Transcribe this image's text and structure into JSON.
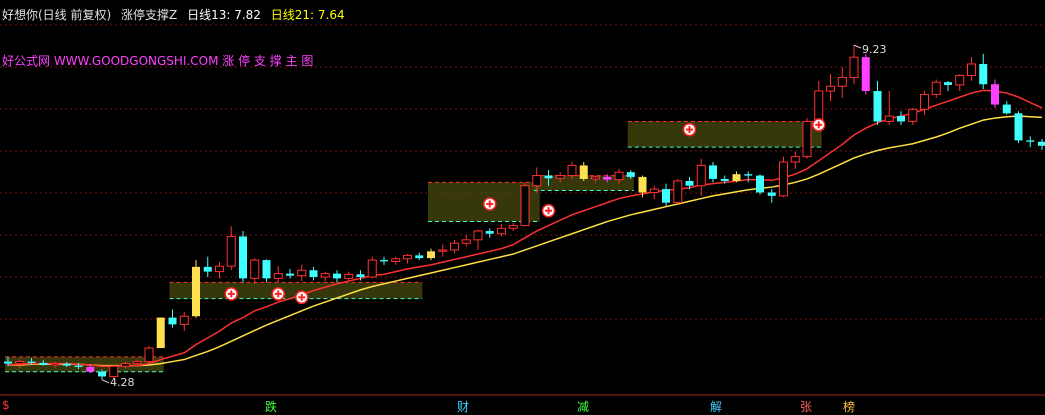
{
  "header": {
    "stock_name": "好想你(日线 前复权)",
    "indicator_name": "涨停支撑Z",
    "ma13_label": "日线13: 7.82",
    "ma21_label": "日线21: 7.64",
    "colors": {
      "name": "#e0e0e0",
      "ma13": "#ffffff",
      "ma21": "#ffff00"
    }
  },
  "watermark": "好公式网 WWW.GOODGONGSHI.COM 涨 停 支 撑 主 图",
  "annotations": {
    "high_label": "9.23",
    "low_label": "4.28"
  },
  "bottom_marks": [
    {
      "text": "$",
      "color": "#ff3030"
    },
    {
      "text": "跌",
      "color": "#40ff40"
    },
    {
      "text": "财",
      "color": "#40d0ff"
    },
    {
      "text": "减",
      "color": "#40ff40"
    },
    {
      "text": "解",
      "color": "#40d0ff"
    },
    {
      "text": "张",
      "color": "#ff6060"
    },
    {
      "text": "榜",
      "color": "#ffc040"
    }
  ],
  "chart_data": {
    "type": "candlestick",
    "ylim": [
      4.1,
      9.6
    ],
    "grid": true,
    "candles": [
      [
        4.55,
        4.62,
        4.48,
        4.52
      ],
      [
        4.52,
        4.58,
        4.45,
        4.55
      ],
      [
        4.55,
        4.6,
        4.5,
        4.53
      ],
      [
        4.53,
        4.57,
        4.49,
        4.5
      ],
      [
        4.5,
        4.55,
        4.46,
        4.52
      ],
      [
        4.52,
        4.54,
        4.47,
        4.49
      ],
      [
        4.49,
        4.53,
        4.44,
        4.47
      ],
      [
        4.47,
        4.5,
        4.38,
        4.4
      ],
      [
        4.4,
        4.43,
        4.28,
        4.33
      ],
      [
        4.33,
        4.5,
        4.3,
        4.48
      ],
      [
        4.48,
        4.55,
        4.45,
        4.52
      ],
      [
        4.52,
        4.58,
        4.49,
        4.55
      ],
      [
        4.55,
        4.78,
        4.53,
        4.75
      ],
      [
        4.75,
        5.2,
        4.75,
        5.2
      ],
      [
        5.2,
        5.32,
        5.05,
        5.1
      ],
      [
        5.1,
        5.28,
        5.0,
        5.22
      ],
      [
        5.22,
        6.05,
        5.2,
        5.95
      ],
      [
        5.95,
        6.1,
        5.8,
        5.88
      ],
      [
        5.88,
        6.02,
        5.78,
        5.96
      ],
      [
        5.96,
        6.55,
        5.9,
        6.4
      ],
      [
        6.4,
        6.48,
        5.72,
        5.78
      ],
      [
        5.78,
        6.08,
        5.7,
        6.05
      ],
      [
        6.05,
        6.06,
        5.72,
        5.78
      ],
      [
        5.78,
        5.96,
        5.72,
        5.85
      ],
      [
        5.85,
        5.92,
        5.78,
        5.82
      ],
      [
        5.82,
        5.98,
        5.74,
        5.9
      ],
      [
        5.9,
        5.95,
        5.75,
        5.8
      ],
      [
        5.8,
        5.88,
        5.74,
        5.85
      ],
      [
        5.85,
        5.9,
        5.72,
        5.78
      ],
      [
        5.78,
        5.88,
        5.74,
        5.84
      ],
      [
        5.84,
        5.9,
        5.75,
        5.8
      ],
      [
        5.8,
        6.1,
        5.78,
        6.05
      ],
      [
        6.05,
        6.1,
        5.98,
        6.03
      ],
      [
        6.03,
        6.1,
        5.98,
        6.07
      ],
      [
        6.07,
        6.14,
        6.0,
        6.12
      ],
      [
        6.12,
        6.16,
        6.05,
        6.08
      ],
      [
        6.08,
        6.22,
        6.05,
        6.18
      ],
      [
        6.18,
        6.28,
        6.1,
        6.2
      ],
      [
        6.2,
        6.35,
        6.15,
        6.3
      ],
      [
        6.3,
        6.42,
        6.25,
        6.35
      ],
      [
        6.35,
        6.5,
        6.2,
        6.48
      ],
      [
        6.48,
        6.52,
        6.38,
        6.44
      ],
      [
        6.44,
        6.58,
        6.4,
        6.52
      ],
      [
        6.52,
        6.6,
        6.48,
        6.56
      ],
      [
        6.56,
        7.2,
        6.55,
        7.15
      ],
      [
        7.15,
        7.42,
        7.05,
        7.3
      ],
      [
        7.3,
        7.38,
        7.15,
        7.26
      ],
      [
        7.26,
        7.35,
        7.2,
        7.3
      ],
      [
        7.3,
        7.5,
        7.25,
        7.45
      ],
      [
        7.45,
        7.5,
        7.22,
        7.25
      ],
      [
        7.25,
        7.3,
        7.2,
        7.28
      ],
      [
        7.28,
        7.32,
        7.2,
        7.24
      ],
      [
        7.24,
        7.4,
        7.18,
        7.35
      ],
      [
        7.35,
        7.38,
        7.25,
        7.28
      ],
      [
        7.28,
        7.3,
        6.98,
        7.05
      ],
      [
        7.05,
        7.15,
        6.95,
        7.1
      ],
      [
        7.1,
        7.18,
        6.85,
        6.9
      ],
      [
        6.9,
        7.25,
        6.88,
        7.22
      ],
      [
        7.22,
        7.28,
        7.1,
        7.15
      ],
      [
        7.15,
        7.55,
        7.0,
        7.45
      ],
      [
        7.45,
        7.5,
        7.2,
        7.25
      ],
      [
        7.25,
        7.3,
        7.18,
        7.22
      ],
      [
        7.22,
        7.36,
        7.2,
        7.32
      ],
      [
        7.32,
        7.36,
        7.2,
        7.3
      ],
      [
        7.3,
        7.32,
        7.02,
        7.05
      ],
      [
        7.05,
        7.1,
        6.9,
        7.0
      ],
      [
        7.0,
        7.58,
        6.98,
        7.5
      ],
      [
        7.5,
        7.65,
        7.4,
        7.58
      ],
      [
        7.58,
        8.15,
        7.55,
        8.1
      ],
      [
        8.1,
        8.7,
        8.05,
        8.55
      ],
      [
        8.55,
        8.8,
        8.4,
        8.62
      ],
      [
        8.62,
        8.9,
        8.45,
        8.75
      ],
      [
        8.75,
        9.23,
        8.65,
        9.05
      ],
      [
        9.05,
        9.1,
        8.5,
        8.55
      ],
      [
        8.55,
        8.7,
        8.05,
        8.1
      ],
      [
        8.1,
        8.55,
        8.05,
        8.18
      ],
      [
        8.18,
        8.25,
        8.05,
        8.1
      ],
      [
        8.1,
        8.3,
        8.05,
        8.28
      ],
      [
        8.28,
        8.55,
        8.2,
        8.5
      ],
      [
        8.5,
        8.72,
        8.45,
        8.68
      ],
      [
        8.68,
        8.7,
        8.55,
        8.64
      ],
      [
        8.64,
        8.8,
        8.55,
        8.78
      ],
      [
        8.78,
        9.05,
        8.7,
        8.95
      ],
      [
        8.95,
        9.1,
        8.58,
        8.65
      ],
      [
        8.65,
        8.72,
        8.3,
        8.35
      ],
      [
        8.35,
        8.4,
        8.2,
        8.22
      ],
      [
        8.22,
        8.25,
        7.78,
        7.82
      ],
      [
        7.82,
        7.88,
        7.72,
        7.8
      ],
      [
        7.8,
        7.84,
        7.68,
        7.74
      ]
    ],
    "ma13": [
      4.5,
      4.51,
      4.52,
      4.52,
      4.52,
      4.52,
      4.51,
      4.5,
      4.48,
      4.48,
      4.49,
      4.49,
      4.52,
      4.58,
      4.63,
      4.68,
      4.8,
      4.9,
      5.0,
      5.12,
      5.2,
      5.3,
      5.36,
      5.43,
      5.48,
      5.54,
      5.6,
      5.65,
      5.7,
      5.74,
      5.78,
      5.82,
      5.84,
      5.88,
      5.92,
      5.95,
      5.98,
      6.02,
      6.06,
      6.1,
      6.14,
      6.18,
      6.22,
      6.28,
      6.38,
      6.48,
      6.56,
      6.64,
      6.72,
      6.78,
      6.84,
      6.9,
      6.96,
      7.0,
      7.03,
      7.06,
      7.08,
      7.1,
      7.12,
      7.16,
      7.18,
      7.2,
      7.22,
      7.24,
      7.24,
      7.23,
      7.27,
      7.32,
      7.4,
      7.52,
      7.64,
      7.76,
      7.9,
      8.0,
      8.08,
      8.14,
      8.18,
      8.22,
      8.28,
      8.34,
      8.4,
      8.46,
      8.52,
      8.56,
      8.55,
      8.52,
      8.46,
      8.38,
      8.3
    ],
    "ma21": [
      4.5,
      4.5,
      4.51,
      4.51,
      4.51,
      4.51,
      4.51,
      4.5,
      4.49,
      4.49,
      4.49,
      4.49,
      4.5,
      4.52,
      4.55,
      4.58,
      4.64,
      4.7,
      4.77,
      4.85,
      4.93,
      5.01,
      5.09,
      5.16,
      5.23,
      5.3,
      5.37,
      5.43,
      5.49,
      5.55,
      5.61,
      5.66,
      5.7,
      5.74,
      5.78,
      5.82,
      5.86,
      5.9,
      5.94,
      5.98,
      6.02,
      6.06,
      6.1,
      6.14,
      6.2,
      6.26,
      6.32,
      6.38,
      6.44,
      6.5,
      6.56,
      6.62,
      6.67,
      6.72,
      6.76,
      6.8,
      6.84,
      6.88,
      6.92,
      6.96,
      7.0,
      7.03,
      7.06,
      7.09,
      7.11,
      7.13,
      7.16,
      7.2,
      7.25,
      7.32,
      7.4,
      7.48,
      7.56,
      7.62,
      7.67,
      7.71,
      7.74,
      7.77,
      7.82,
      7.87,
      7.93,
      8.0,
      8.06,
      8.12,
      8.15,
      8.17,
      8.18,
      8.17,
      8.16
    ],
    "zones": [
      {
        "start": 0,
        "end": 13,
        "top": 4.62,
        "bottom": 4.4
      },
      {
        "start": 14,
        "end": 35,
        "top": 5.72,
        "bottom": 5.48
      },
      {
        "start": 36,
        "end": 45,
        "top": 7.2,
        "bottom": 6.62
      },
      {
        "start": 45,
        "end": 53,
        "top": 7.3,
        "bottom": 7.08
      },
      {
        "start": 53,
        "end": 69,
        "top": 8.1,
        "bottom": 7.72
      }
    ],
    "buy_signals": [
      {
        "index": 19,
        "price": 5.55
      },
      {
        "index": 23,
        "price": 5.55
      },
      {
        "index": 25,
        "price": 5.5
      },
      {
        "index": 41,
        "price": 6.88
      },
      {
        "index": 46,
        "price": 6.78
      },
      {
        "index": 58,
        "price": 7.98
      },
      {
        "index": 69,
        "price": 8.05
      }
    ],
    "limit_up_bars": [
      13,
      16,
      36,
      49,
      54,
      62
    ]
  }
}
